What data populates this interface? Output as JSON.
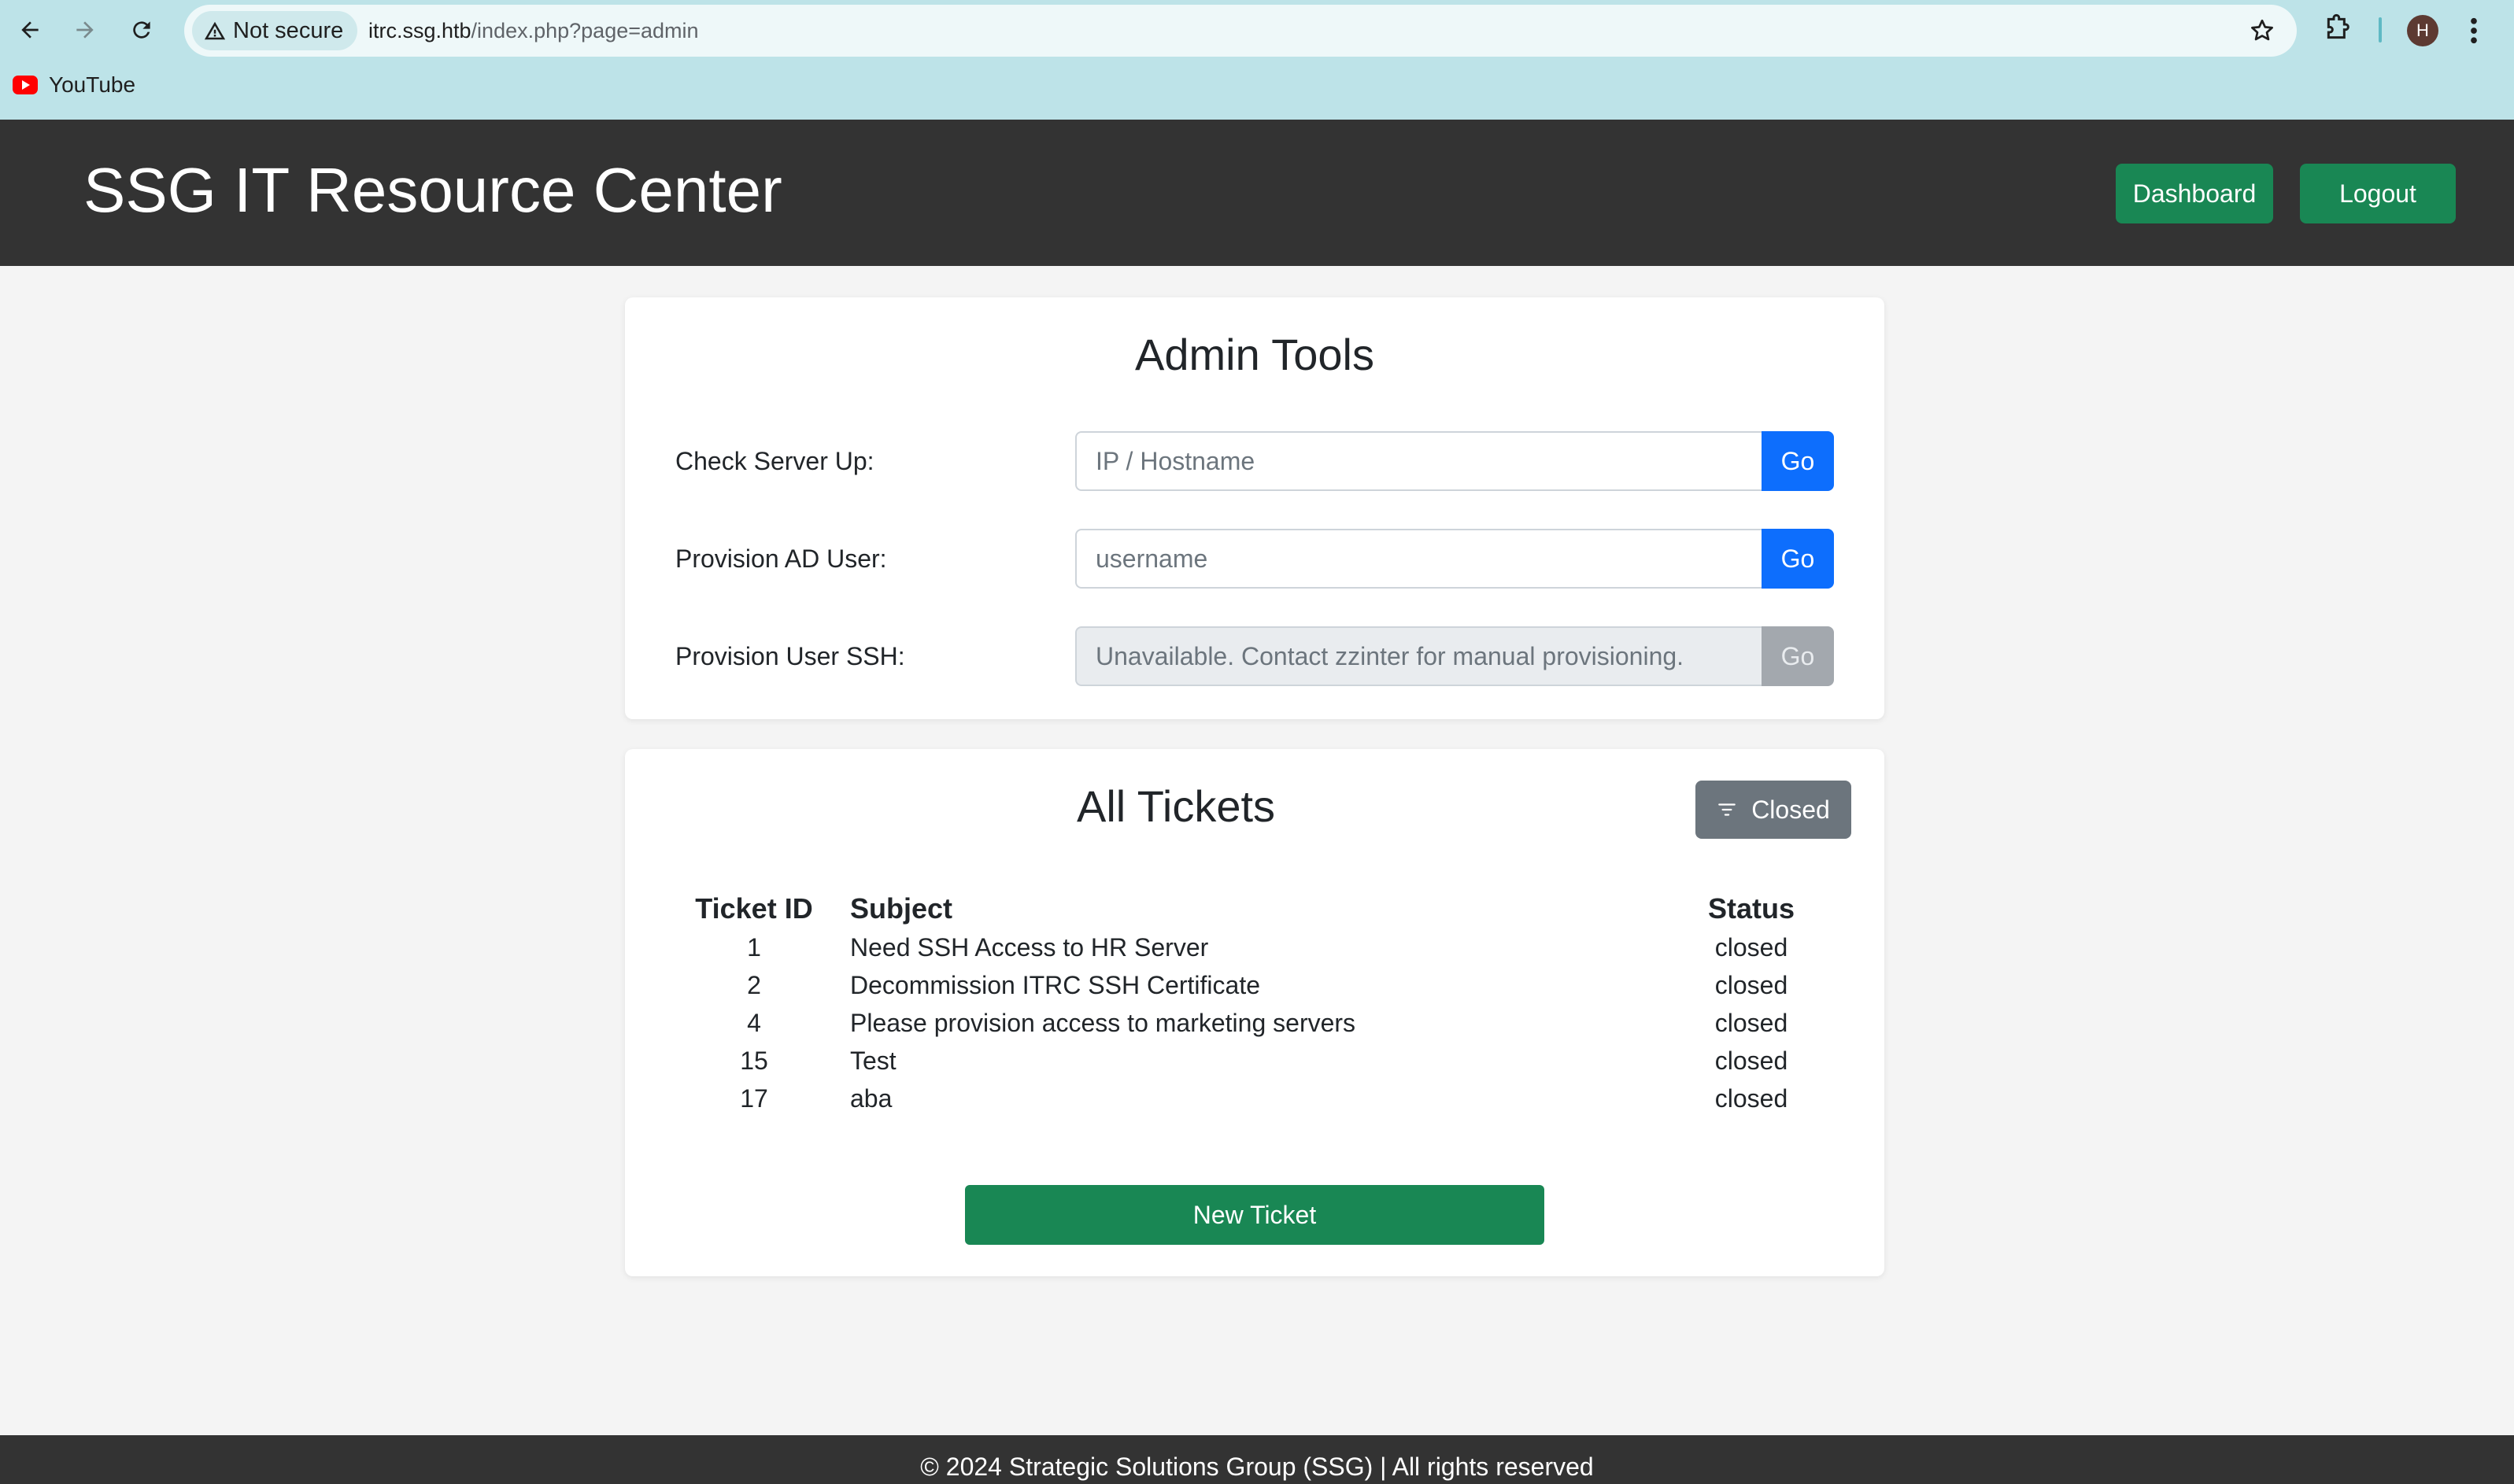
{
  "browser": {
    "security_label": "Not secure",
    "url_host": "itrc.ssg.htb",
    "url_path": "/index.php?page=admin",
    "profile_initial": "H",
    "bookmarks": [
      {
        "label": "YouTube",
        "icon": "youtube-icon"
      }
    ]
  },
  "header": {
    "title": "SSG IT Resource Center",
    "dashboard_label": "Dashboard",
    "logout_label": "Logout"
  },
  "admin_tools": {
    "title": "Admin Tools",
    "rows": [
      {
        "label": "Check Server Up:",
        "placeholder": "IP / Hostname",
        "value": "",
        "button": "Go",
        "disabled": false
      },
      {
        "label": "Provision AD User:",
        "placeholder": "username",
        "value": "",
        "button": "Go",
        "disabled": false
      },
      {
        "label": "Provision User SSH:",
        "placeholder": "Unavailable. Contact zzinter for manual provisioning.",
        "value": "",
        "button": "Go",
        "disabled": true
      }
    ]
  },
  "tickets": {
    "title": "All Tickets",
    "filter_label": "Closed",
    "columns": {
      "id": "Ticket ID",
      "subject": "Subject",
      "status": "Status"
    },
    "rows": [
      {
        "id": "1",
        "subject": "Need SSH Access to HR Server",
        "status": "closed"
      },
      {
        "id": "2",
        "subject": "Decommission ITRC SSH Certificate",
        "status": "closed"
      },
      {
        "id": "4",
        "subject": "Please provision access to marketing servers",
        "status": "closed"
      },
      {
        "id": "15",
        "subject": "Test",
        "status": "closed"
      },
      {
        "id": "17",
        "subject": "aba",
        "status": "closed"
      }
    ],
    "new_ticket_label": "New Ticket"
  },
  "footer": {
    "text": "© 2024 Strategic Solutions Group (SSG) | All rights reserved"
  },
  "colors": {
    "header_bg": "#333333",
    "success": "#198754",
    "primary": "#0d6efd",
    "secondary": "#6c757d"
  }
}
